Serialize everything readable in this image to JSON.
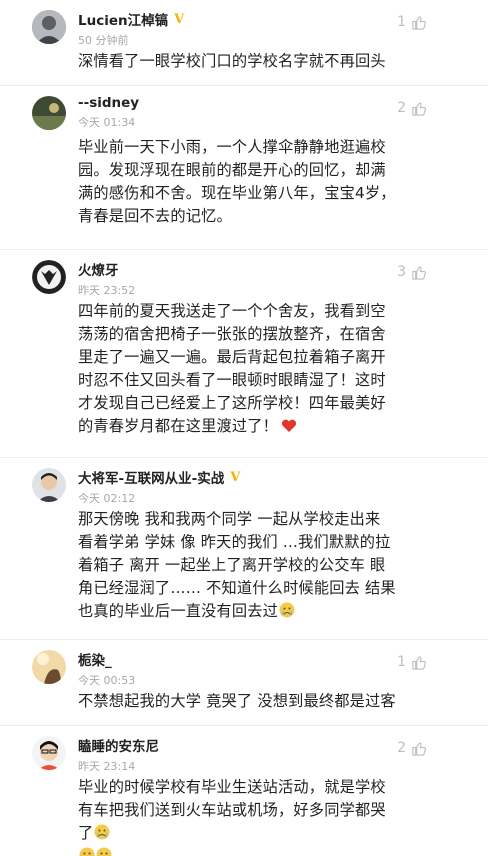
{
  "comments": [
    {
      "user": "Lucien江棹镐",
      "verified": true,
      "time": "50 分钟前",
      "likes": "1",
      "text": "深情看了一眼学校门口的学校名字就不再回头",
      "emoji": "",
      "avatar_color": "#8a8f96"
    },
    {
      "user": "--sidney",
      "verified": false,
      "time": "今天 01:34",
      "likes": "2",
      "text": "毕业前一天下小雨，一个人撑伞静静地逛遍校园。发现浮现在眼前的都是开心的回忆，却满满的感伤和不舍。现在毕业第八年，宝宝4岁，青春是回不去的记忆。",
      "emoji": "",
      "avatar_color": "#3e4a32"
    },
    {
      "user": "火燎牙",
      "verified": false,
      "time": "昨天 23:52",
      "likes": "3",
      "text": "四年前的夏天我送走了一个个舍友，我看到空荡荡的宿舍把椅子一张张的摆放整齐，在宿舍里走了一遍又一遍。最后背起包拉着箱子离开时忍不住又回头看了一眼顿时眼睛湿了！这时才发现自己已经爱上了这所学校！四年最美好的青春岁月都在这里渡过了！",
      "emoji": "heart",
      "avatar_color": "#222222"
    },
    {
      "user": "大将军-互联网从业-实战",
      "verified": true,
      "time": "今天 02:12",
      "likes": "",
      "text": "那天傍晚 我和我两个同学 一起从学校走出来 看着学弟 学妹 像 昨天的我们 …我们默默的拉着箱子 离开 一起坐上了离开学校的公交车 眼角已经湿润了…… 不知道什么时候能回去 结果也真的毕业后一直没有回去过",
      "emoji": "cry",
      "avatar_color": "#c9cdd2"
    },
    {
      "user": "栀染_",
      "verified": false,
      "time": "今天 00:53",
      "likes": "1",
      "text": "不禁想起我的大学 竟哭了 没想到最终都是过客",
      "emoji": "",
      "avatar_color": "#e6b77a"
    },
    {
      "user": "瞌睡的安东尼",
      "verified": false,
      "time": "昨天 23:14",
      "likes": "2",
      "text": "毕业的时候学校有毕业生送站活动，就是学校有车把我们送到火车站或机场，好多同学都哭了",
      "emoji": "cry2",
      "avatar_color": "#d9dde2"
    }
  ],
  "icons": {
    "like": "thumbs-up-icon",
    "verified": "verified-v-icon"
  },
  "colors": {
    "verified": "#f5b400",
    "meta": "#a8a8a8",
    "like": "#bdbdbd",
    "heart": "#e0362c"
  }
}
